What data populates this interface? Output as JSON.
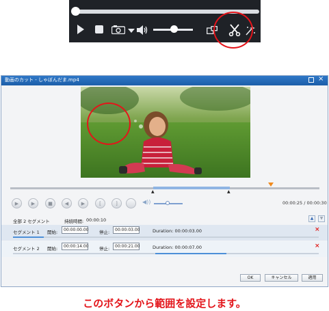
{
  "dialog": {
    "title": "動画のカット - しゃぼんだま.mp4",
    "time_readout": "00:00:25 / 00:00:30",
    "segment_count": "全部 2 セグメント",
    "duration_label": "持続時間:",
    "duration_value": "00:00:10",
    "segments": [
      {
        "label": "セグメント 1",
        "start_label": "開始:",
        "start": "00:00:00.00",
        "stop_label": "停止:",
        "stop": "00:00:03.00",
        "duration": "Duration: 00:00:03.00"
      },
      {
        "label": "セグメント 2",
        "start_label": "開始:",
        "start": "00:00:14.00",
        "stop_label": "停止:",
        "stop": "00:00:21.00",
        "duration": "Duration: 00:00:07.00"
      }
    ],
    "buttons": {
      "ok": "OK",
      "cancel": "キャンセル",
      "apply": "適用"
    }
  },
  "caption": "このボタンから範囲を設定します。",
  "colors": {
    "accent_red": "#e3141a",
    "title_blue": "#2f78c8",
    "dark_player": "#1f2227"
  }
}
